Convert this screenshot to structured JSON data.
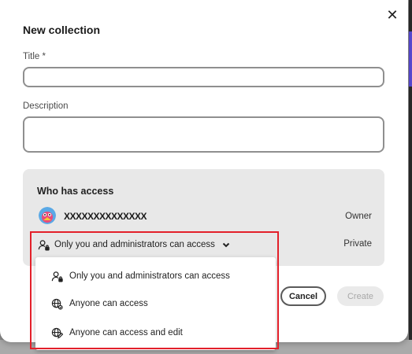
{
  "dialog": {
    "title": "New collection",
    "close_glyph": "✕",
    "title_field": {
      "label": "Title *",
      "value": "",
      "placeholder": ""
    },
    "description_field": {
      "label": "Description",
      "value": "",
      "placeholder": ""
    }
  },
  "access": {
    "heading": "Who has access",
    "user": {
      "name": "XXXXXXXXXXXXXX",
      "role": "Owner",
      "avatar_icon": "avatar-icon"
    },
    "selected_option": "Only you and administrators can access",
    "visibility": "Private"
  },
  "dropdown": {
    "options": [
      {
        "label": "Only you and administrators can access",
        "icon": "person-lock-icon"
      },
      {
        "label": "Anyone can access",
        "icon": "globe-icon"
      },
      {
        "label": "Anyone can access and edit",
        "icon": "globe-edit-icon"
      }
    ]
  },
  "buttons": {
    "cancel": "Cancel",
    "create": "Create"
  },
  "colors": {
    "highlight": "#e3202a",
    "panel_bg": "#e8e8e8",
    "modal_bg": "#ffffff"
  }
}
